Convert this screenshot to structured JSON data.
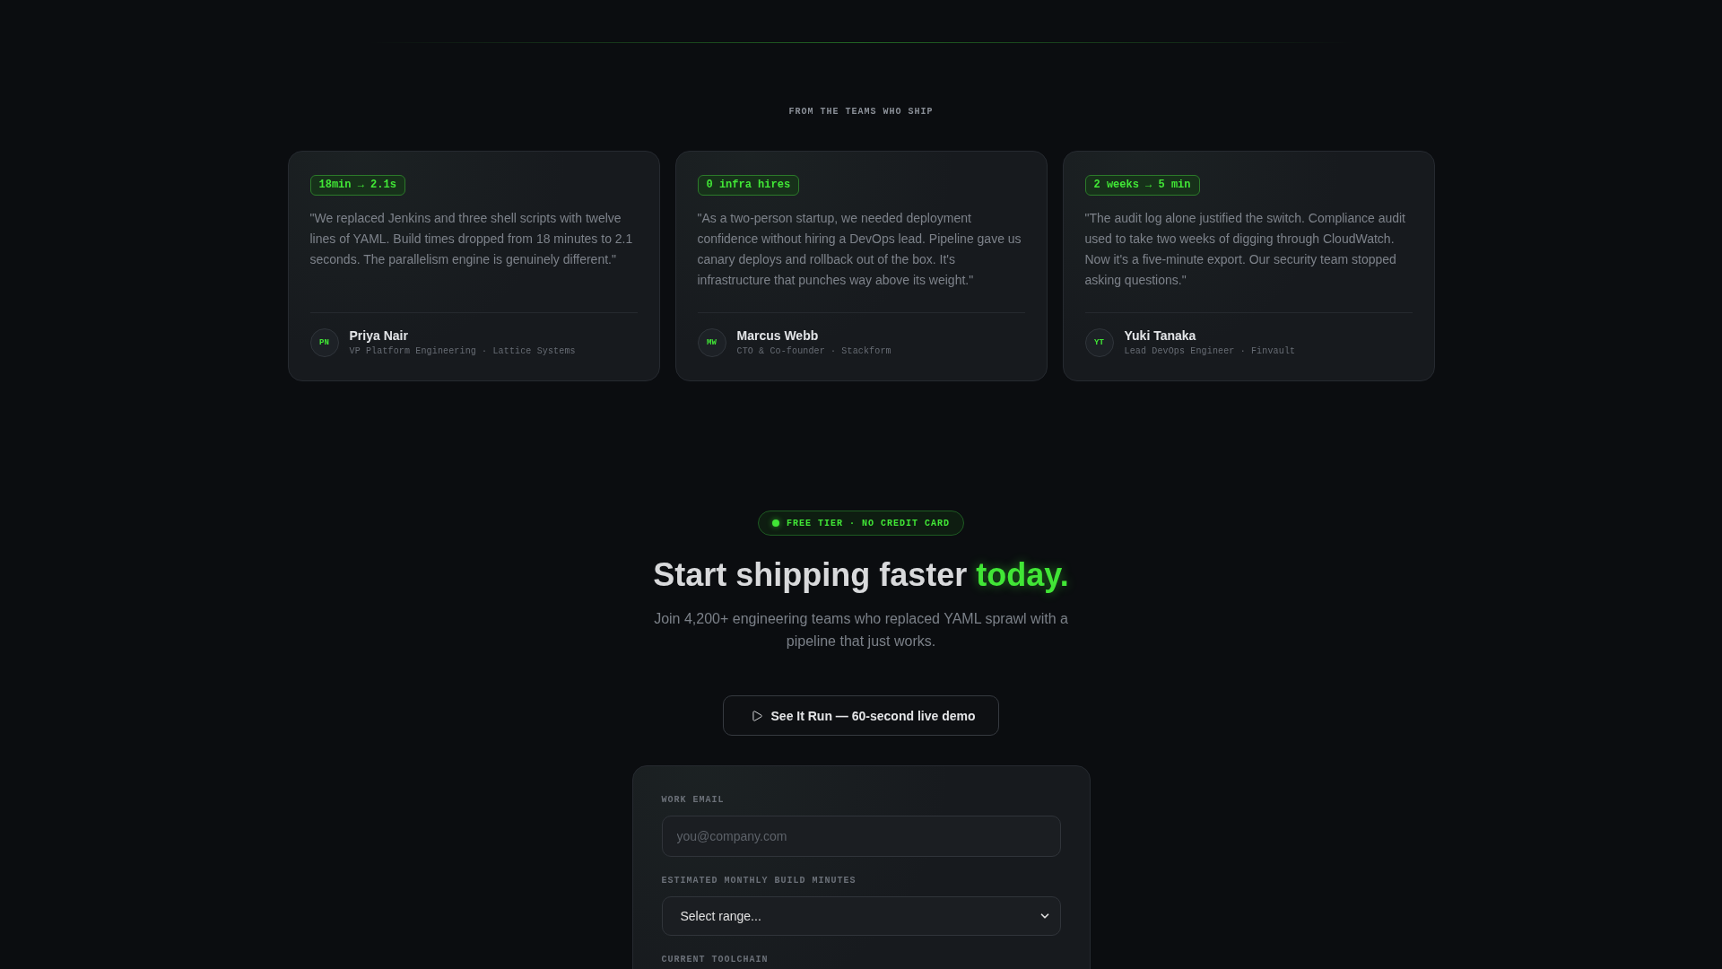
{
  "testimonials_section": {
    "eyebrow": "FROM THE TEAMS WHO SHIP",
    "testimonials": [
      {
        "metric": "18min → 2.1s",
        "quote": "\"We replaced Jenkins and three shell scripts with twelve lines of YAML. Build times dropped from 18 minutes to 2.1 seconds. The parallelism engine is genuinely different.\"",
        "initials": "PN",
        "name": "Priya Nair",
        "role": "VP Platform Engineering · Lattice Systems"
      },
      {
        "metric": "0 infra hires",
        "quote": "\"As a two-person startup, we needed deployment confidence without hiring a DevOps lead. Pipeline gave us canary deploys and rollback out of the box. It's infrastructure that punches way above its weight.\"",
        "initials": "MW",
        "name": "Marcus Webb",
        "role": "CTO & Co-founder · Stackform"
      },
      {
        "metric": "2 weeks → 5 min",
        "quote": "\"The audit log alone justified the switch. Compliance audit used to take two weeks of digging through CloudWatch. Now it's a five-minute export. Our security team stopped asking questions.\"",
        "initials": "YT",
        "name": "Yuki Tanaka",
        "role": "Lead DevOps Engineer · Finvault"
      }
    ]
  },
  "cta": {
    "pill": "FREE TIER · NO CREDIT CARD",
    "heading": {
      "text": "Start shipping faster",
      "highlight": "today."
    },
    "subtitle": "Join 4,200+ engineering teams who replaced YAML sprawl with a pipeline that just works.",
    "demo_button": "See It Run — 60-second live demo"
  },
  "signup_form": {
    "fields": [
      {
        "kind": "input",
        "label": "WORK EMAIL",
        "placeholder": "you@company.com"
      },
      {
        "kind": "select",
        "label": "ESTIMATED MONTHLY BUILD MINUTES",
        "value": "Select range..."
      },
      {
        "kind": "label",
        "label": "CURRENT TOOLCHAIN"
      }
    ]
  }
}
